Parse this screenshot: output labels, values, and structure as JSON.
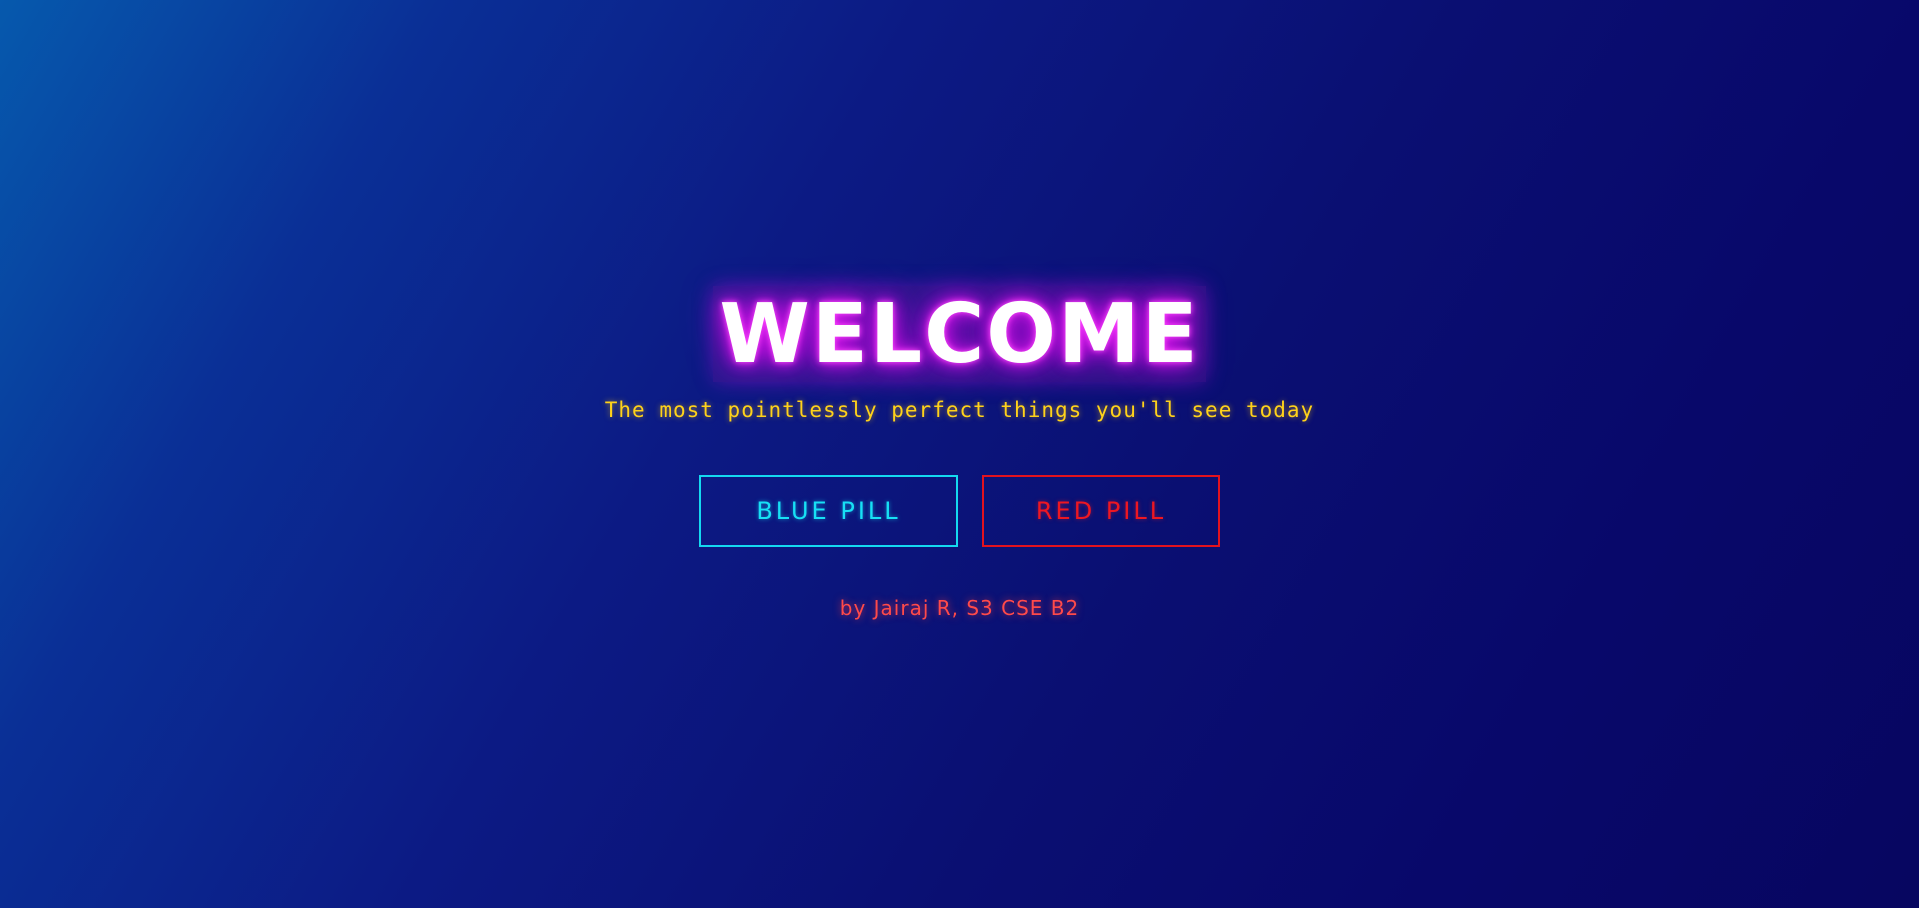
{
  "hero": {
    "title": "WELCOME",
    "subtitle": "The most pointlessly perfect things you'll see today"
  },
  "actions": {
    "blue_pill_label": "BLUE PILL",
    "red_pill_label": "RED PILL"
  },
  "footer": {
    "byline": "by Jairaj R, S3 CSE B2"
  },
  "colors": {
    "title_glow": "#c10ae0",
    "subtitle": "#ffd21a",
    "blue_pill": "#14d9f0",
    "red_pill": "#e3121e",
    "byline": "#ff4a4a",
    "background_start": "#0659ad",
    "background_end": "#070660"
  }
}
